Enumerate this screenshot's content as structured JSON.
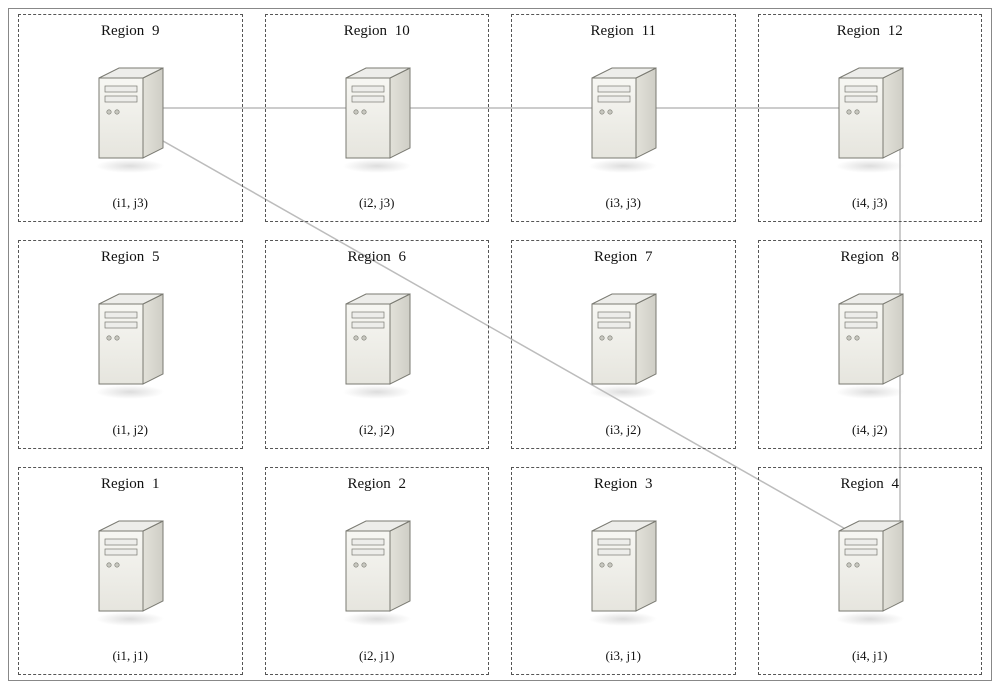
{
  "outer_border": true,
  "connections": [
    {
      "from": "region-9",
      "to": "region-10",
      "type": "horizontal"
    },
    {
      "from": "region-10",
      "to": "region-11",
      "type": "horizontal"
    },
    {
      "from": "region-11",
      "to": "region-12",
      "type": "horizontal"
    },
    {
      "from": "region-12",
      "to": "region-8",
      "type": "vertical"
    },
    {
      "from": "region-8",
      "to": "region-4",
      "type": "vertical"
    },
    {
      "from": "region-9",
      "to": "region-4",
      "type": "diagonal"
    }
  ],
  "region_prefix": "Region",
  "grid": {
    "rows": 3,
    "cols": 4
  },
  "regions": [
    {
      "id": 9,
      "row": 0,
      "col": 0,
      "label": "Region",
      "num": "9",
      "coord": "(i1, j3)"
    },
    {
      "id": 10,
      "row": 0,
      "col": 1,
      "label": "Region",
      "num": "10",
      "coord": "(i2, j3)"
    },
    {
      "id": 11,
      "row": 0,
      "col": 2,
      "label": "Region",
      "num": "11",
      "coord": "(i3, j3)"
    },
    {
      "id": 12,
      "row": 0,
      "col": 3,
      "label": "Region",
      "num": "12",
      "coord": "(i4, j3)"
    },
    {
      "id": 5,
      "row": 1,
      "col": 0,
      "label": "Region",
      "num": "5",
      "coord": "(i1, j2)"
    },
    {
      "id": 6,
      "row": 1,
      "col": 1,
      "label": "Region",
      "num": "6",
      "coord": "(i2, j2)"
    },
    {
      "id": 7,
      "row": 1,
      "col": 2,
      "label": "Region",
      "num": "7",
      "coord": "(i3, j2)"
    },
    {
      "id": 8,
      "row": 1,
      "col": 3,
      "label": "Region",
      "num": "8",
      "coord": "(i4, j2)"
    },
    {
      "id": 1,
      "row": 2,
      "col": 0,
      "label": "Region",
      "num": "1",
      "coord": "(i1, j1)"
    },
    {
      "id": 2,
      "row": 2,
      "col": 1,
      "label": "Region",
      "num": "2",
      "coord": "(i2, j1)"
    },
    {
      "id": 3,
      "row": 2,
      "col": 2,
      "label": "Region",
      "num": "3",
      "coord": "(i3, j1)"
    },
    {
      "id": 4,
      "row": 2,
      "col": 3,
      "label": "Region",
      "num": "4",
      "coord": "(i4, j1)"
    }
  ],
  "colors": {
    "server_fill_light": "#f5f5f1",
    "server_fill_dark": "#e2e1d9",
    "server_fill_top": "#ededea",
    "server_stroke": "#7a7a72",
    "dash_border": "#555555",
    "connection": "#bcbcbc"
  }
}
